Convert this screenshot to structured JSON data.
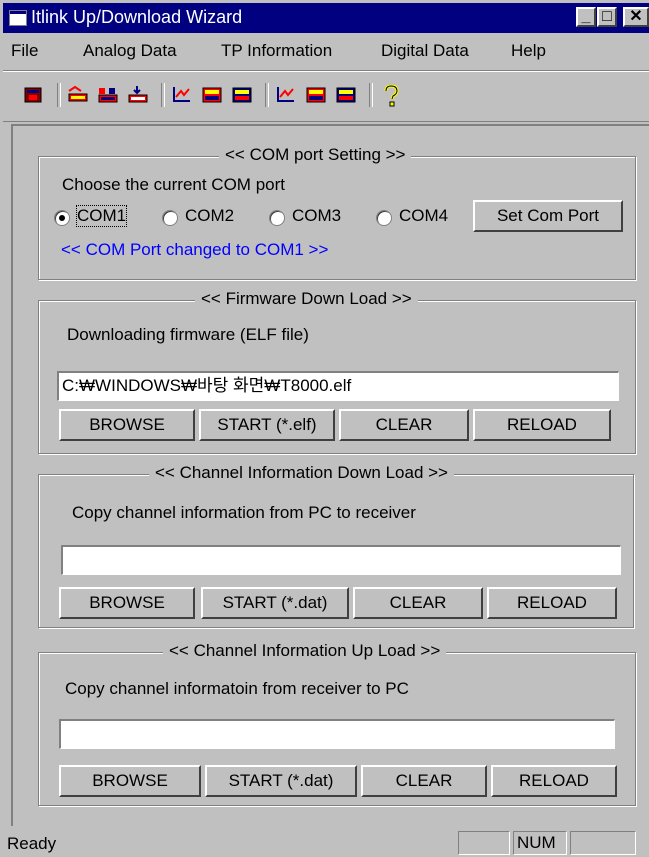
{
  "window": {
    "title": "Itlink Up/Download Wizard"
  },
  "titlebar": {
    "min_glyph": "_",
    "max_glyph": "□",
    "close_glyph": "✕"
  },
  "menu": [
    {
      "label": "File"
    },
    {
      "label": "Analog Data"
    },
    {
      "label": "TP Information"
    },
    {
      "label": "Digital Data"
    },
    {
      "label": "Help"
    }
  ],
  "toolbar": {
    "icons": [
      "app-icon",
      "analog-open-icon",
      "analog-save-icon",
      "analog-download-icon",
      "tp-upload-icon",
      "tp-save-icon",
      "tp-download-icon",
      "digital-upload-icon",
      "digital-save-icon",
      "digital-download-icon",
      "help-icon"
    ],
    "colors": {
      "red": "#ff0000",
      "navy": "#000080",
      "yellow": "#ffff00"
    }
  },
  "com_group": {
    "legend": "<< COM port Setting >>",
    "prompt": "Choose the current COM port",
    "ports": [
      "COM1",
      "COM2",
      "COM3",
      "COM4"
    ],
    "selected": "COM1",
    "set_button": "Set Com Port",
    "status": "<< COM Port changed to COM1 >>",
    "status_color": "#0000ff"
  },
  "firmware_group": {
    "legend": "<< Firmware Down Load >>",
    "prompt": "Downloading firmware (ELF file)",
    "path": "C:₩WINDOWS₩바탕 화면₩T8000.elf",
    "browse": "BROWSE",
    "start": "START (*.elf)",
    "clear": "CLEAR",
    "reload": "RELOAD"
  },
  "channel_down_group": {
    "legend": "<< Channel Information Down Load >>",
    "prompt": "Copy channel information from PC to receiver",
    "path": "",
    "browse": "BROWSE",
    "start": "START (*.dat)",
    "clear": "CLEAR",
    "reload": "RELOAD"
  },
  "channel_up_group": {
    "legend": "<< Channel Information Up Load >>",
    "prompt": "Copy channel informatoin from receiver to PC",
    "path": "",
    "browse": "BROWSE",
    "start": "START (*.dat)",
    "clear": "CLEAR",
    "reload": "RELOAD"
  },
  "statusbar": {
    "text": "Ready",
    "num": "NUM"
  }
}
